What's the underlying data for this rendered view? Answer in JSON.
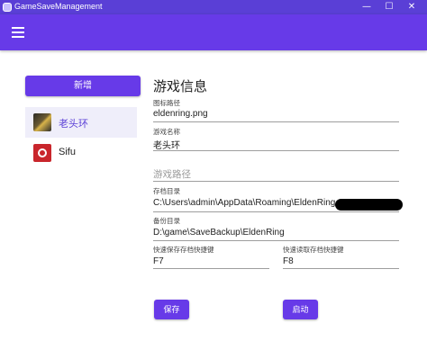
{
  "window": {
    "title": "GameSaveManagement",
    "minimize_glyph": "—",
    "maximize_glyph": "☐",
    "close_glyph": "✕"
  },
  "appbar": {
    "menu_icon": "hamburger-menu-icon"
  },
  "sidebar": {
    "add_label": "新增",
    "games": [
      {
        "name": "老头环",
        "icon": "elden-ring-thumbnail",
        "selected": true
      },
      {
        "name": "Sifu",
        "icon": "sifu-thumbnail",
        "selected": false
      }
    ]
  },
  "game_info": {
    "title": "游戏信息",
    "icon_path_label": "图标路径",
    "icon_path_value": "eldenring.png",
    "game_name_label": "游戏名称",
    "game_name_value": "老头环"
  },
  "game_path": {
    "title": "游戏路径",
    "save_dir_label": "存档目录",
    "save_dir_value": "C:\\Users\\admin\\AppData\\Roaming\\EldenRing",
    "backup_dir_label": "备份目录",
    "backup_dir_value": "D:\\game\\SaveBackup\\EldenRing",
    "quick_save_label": "快速保存存档快捷键",
    "quick_save_value": "F7",
    "quick_load_label": "快速读取存档快捷键",
    "quick_load_value": "F8"
  },
  "actions": {
    "save_label": "保存",
    "launch_label": "启动"
  },
  "colors": {
    "titlebar": "#5a3fd6",
    "accent": "#673ae8",
    "selected_bg": "#efeefa"
  }
}
